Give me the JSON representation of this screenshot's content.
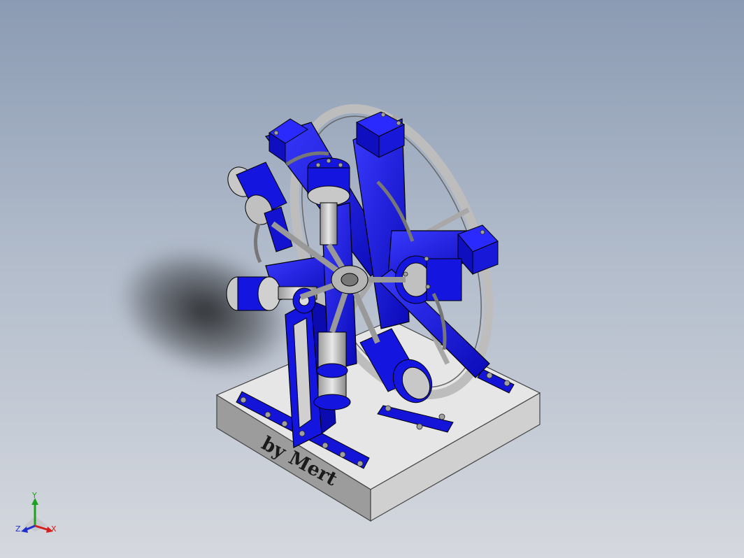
{
  "model": {
    "engraving_text": "by Mert",
    "part_color": "#1010e0",
    "frame_color": "#d8d8d8",
    "base_color": "#e6e6e6"
  },
  "triad": {
    "x_label": "X",
    "y_label": "Y",
    "z_label": "Z",
    "x_color": "#d62020",
    "y_color": "#20a020",
    "z_color": "#2030d0"
  }
}
